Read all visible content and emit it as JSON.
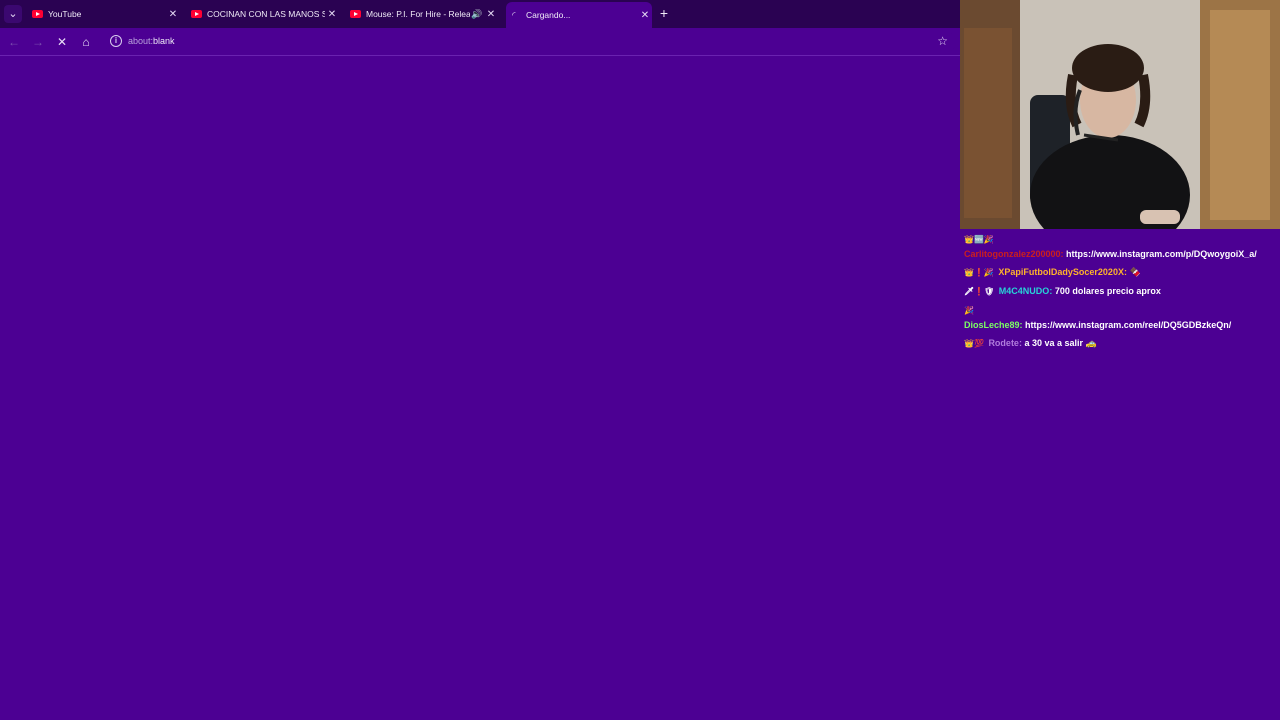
{
  "browser": {
    "tabs": [
      {
        "title": "YouTube",
        "active": false,
        "audio": false
      },
      {
        "title": "COCINAN CON LAS MANOS SU",
        "active": false,
        "audio": false
      },
      {
        "title": "Mouse: P.I. For Hire - Relea",
        "active": false,
        "audio": true
      },
      {
        "title": "Cargando...",
        "active": true,
        "audio": false
      }
    ],
    "address": {
      "scheme": "about:",
      "rest": "blank"
    }
  },
  "chat": {
    "messages": [
      {
        "badges": "👑🆕🎉",
        "user": "Carlitogonzalez200000",
        "user_color": "#cc1e1e",
        "text": "https://www.instagram.com/p/DQwoygoiX_a/"
      },
      {
        "badges": "👑❗🎉",
        "user": "XPapiFutbolDadySocer2020X",
        "user_color": "#ffb32b",
        "text": "🍫"
      },
      {
        "badges": "🗡❗🛡",
        "user": "M4C4NUDO",
        "user_color": "#27d3d8",
        "text": "700 dolares precio aprox"
      },
      {
        "badges": "🎉",
        "user": "DiosLeche89",
        "user_color": "#7cff63",
        "text": "https://www.instagram.com/reel/DQ5GDBzkeQn/"
      },
      {
        "badges": "👑💯",
        "user": "Rodete",
        "user_color": "#b07bdc",
        "text": "a 30 va a salir 🚕"
      }
    ]
  }
}
